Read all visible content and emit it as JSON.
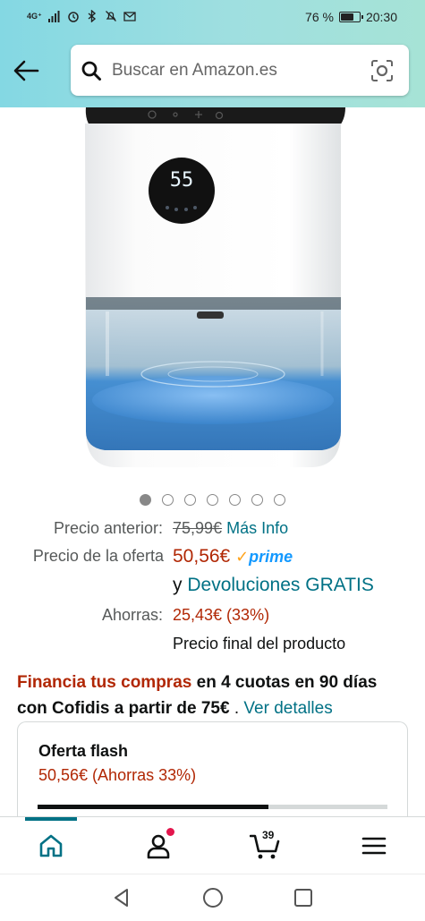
{
  "status_bar": {
    "network": "4G⁺",
    "battery_percent": "76 %",
    "battery_level": 0.76,
    "time": "20:30",
    "icons": [
      "signal-icon",
      "alarm-icon",
      "bluetooth-icon",
      "silent-icon",
      "gmail-icon"
    ]
  },
  "header": {
    "search_placeholder": "Buscar en Amazon.es",
    "colors": {
      "gradient_start": "#84d8e3",
      "gradient_end": "#a6e3d6"
    }
  },
  "product": {
    "display_digits": "55",
    "carousel": {
      "count": 7,
      "active_index": 0
    }
  },
  "pricing": {
    "previous_label": "Precio anterior:",
    "previous_price": "75,99€",
    "more_info": "Más Info",
    "deal_label": "Precio de la oferta",
    "deal_price": "50,56€",
    "prime_check": "✓",
    "prime_word": "prime",
    "returns_prefix": "y ",
    "returns_link": "Devoluciones GRATIS",
    "savings_label": "Ahorras:",
    "savings_value": "25,43€ (33%)",
    "final_note": "Precio final del producto"
  },
  "financing": {
    "highlight": "Financia tus compras",
    "rest": " en 4 cuotas en 90 días con Cofidis a partir de 75€",
    "separator": " . ",
    "details_link": "Ver detalles"
  },
  "flash_deal": {
    "title": "Oferta flash",
    "price_line": "50,56€ (Ahorras 33%)",
    "progress": 0.66
  },
  "bottom_nav": {
    "items": [
      "home-icon",
      "account-icon",
      "cart-icon",
      "menu-icon"
    ],
    "cart_count": "39",
    "active": "home"
  },
  "colors": {
    "price_red": "#b12704",
    "link_teal": "#007185",
    "prime_blue": "#1399ff",
    "prime_orange": "#ffa41c"
  }
}
